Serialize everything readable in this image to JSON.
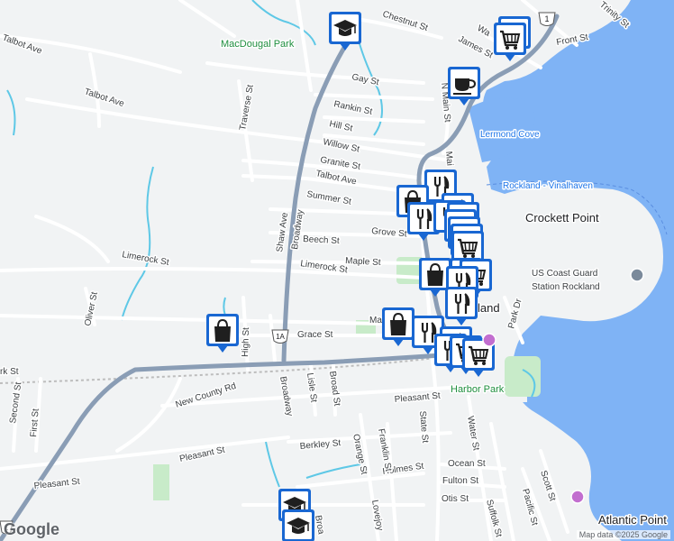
{
  "map": {
    "attribution": "Map data ©2025 Google",
    "logo": "Google",
    "route_shields": [
      "1",
      "1",
      "1A"
    ],
    "area_labels": {
      "park_macdougal": "MacDougal Park",
      "cove": "Lermond Cove",
      "ferry": "Rockland - Vinalhaven",
      "point_crockett": "Crockett Point",
      "coast_guard_line1": "US Coast Guard",
      "coast_guard_line2": "Station Rockland",
      "harbor_park": "Harbor Park",
      "atlantic_point": "Atlantic Point",
      "rockland_partial": "land"
    },
    "streets": {
      "chestnut": "Chestnut St",
      "talbot_nw": "Talbot Ave",
      "talbot_w": "Talbot Ave",
      "talbot_e": "Talbot Ave",
      "james": "James St",
      "front": "Front St",
      "gay": "Gay St",
      "rankin": "Rankin St",
      "hill": "Hill St",
      "willow": "Willow St",
      "granite": "Granite St",
      "summer": "Summer St",
      "grove": "Grove St",
      "beech": "Beech St",
      "maple": "Maple St",
      "limerock_w": "Limerock St",
      "limerock_e": "Limerock St",
      "grace": "Grace St",
      "main_mid": "Ma",
      "pleasant_e": "Pleasant St",
      "pleasant_w": "Pleasant St",
      "pleasant_sw": "Pleasant St",
      "berkley": "Berkley St",
      "holmes": "Holmes St",
      "ocean": "Ocean St",
      "fulton": "Fulton St",
      "otis": "Otis St",
      "new_county": "New County Rd",
      "traverse": "Traverse St",
      "shaw": "Shaw Ave",
      "broadway_n": "Broadway",
      "broadway_s": "Broadway",
      "broadway_ss": "Broa",
      "oliver": "Oliver St",
      "second": "Second St",
      "first": "First St",
      "park_w": "rk St",
      "high": "High St",
      "lisle": "Lisle St",
      "broad": "Broad St",
      "orange": "Orange St",
      "franklin": "Franklin St",
      "lovejoy": "Lovejoy",
      "state": "State St",
      "water": "Water St",
      "suffolk": "Suffolk St",
      "pacific": "Pacific St",
      "scott": "Scott St",
      "park_dr": "Park Dr",
      "n_main": "N Main St",
      "main_n": "Mai",
      "wa": "Wa",
      "trinity": "Trinity St"
    },
    "markers": [
      {
        "type": "school"
      },
      {
        "type": "grocery"
      },
      {
        "type": "grocery"
      },
      {
        "type": "cafe"
      },
      {
        "type": "restaurant"
      },
      {
        "type": "shopping"
      },
      {
        "type": "restaurant"
      },
      {
        "type": "restaurant"
      },
      {
        "type": "restaurant"
      },
      {
        "type": "grocery"
      },
      {
        "type": "grocery"
      },
      {
        "type": "grocery"
      },
      {
        "type": "grocery"
      },
      {
        "type": "grocery"
      },
      {
        "type": "shopping"
      },
      {
        "type": "restaurant"
      },
      {
        "type": "grocery"
      },
      {
        "type": "restaurant"
      },
      {
        "type": "restaurant"
      },
      {
        "type": "shopping"
      },
      {
        "type": "shopping"
      },
      {
        "type": "restaurant"
      },
      {
        "type": "restaurant"
      },
      {
        "type": "restaurant"
      },
      {
        "type": "grocery"
      },
      {
        "type": "grocery"
      },
      {
        "type": "school"
      },
      {
        "type": "school"
      }
    ],
    "colors": {
      "background": "#f1f3f4",
      "water": "#7fb3f5",
      "highway": "#8a9db5",
      "street": "#ffffff",
      "park": "#c8ebc9",
      "stream": "#5ec8e6",
      "marker": "#1967d2"
    }
  }
}
